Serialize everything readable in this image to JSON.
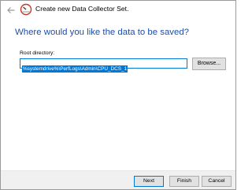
{
  "window": {
    "title": "Create new Data Collector Set."
  },
  "page": {
    "heading": "Where would you like the data to be saved?"
  },
  "root_directory": {
    "label": "Root directory:",
    "value": "%systemdrive%\\PerfLogs\\Admin\\CPU_DCS_1"
  },
  "buttons": {
    "browse": "Browse...",
    "next": "Next",
    "finish": "Finish",
    "cancel": "Cancel"
  },
  "colors": {
    "heading": "#1e4ea8",
    "selection": "#0078d7",
    "footer": "#f0f0f0",
    "button": "#e1e1e1"
  },
  "icons": {
    "back": "back-arrow-icon",
    "app": "perfmon-icon"
  }
}
